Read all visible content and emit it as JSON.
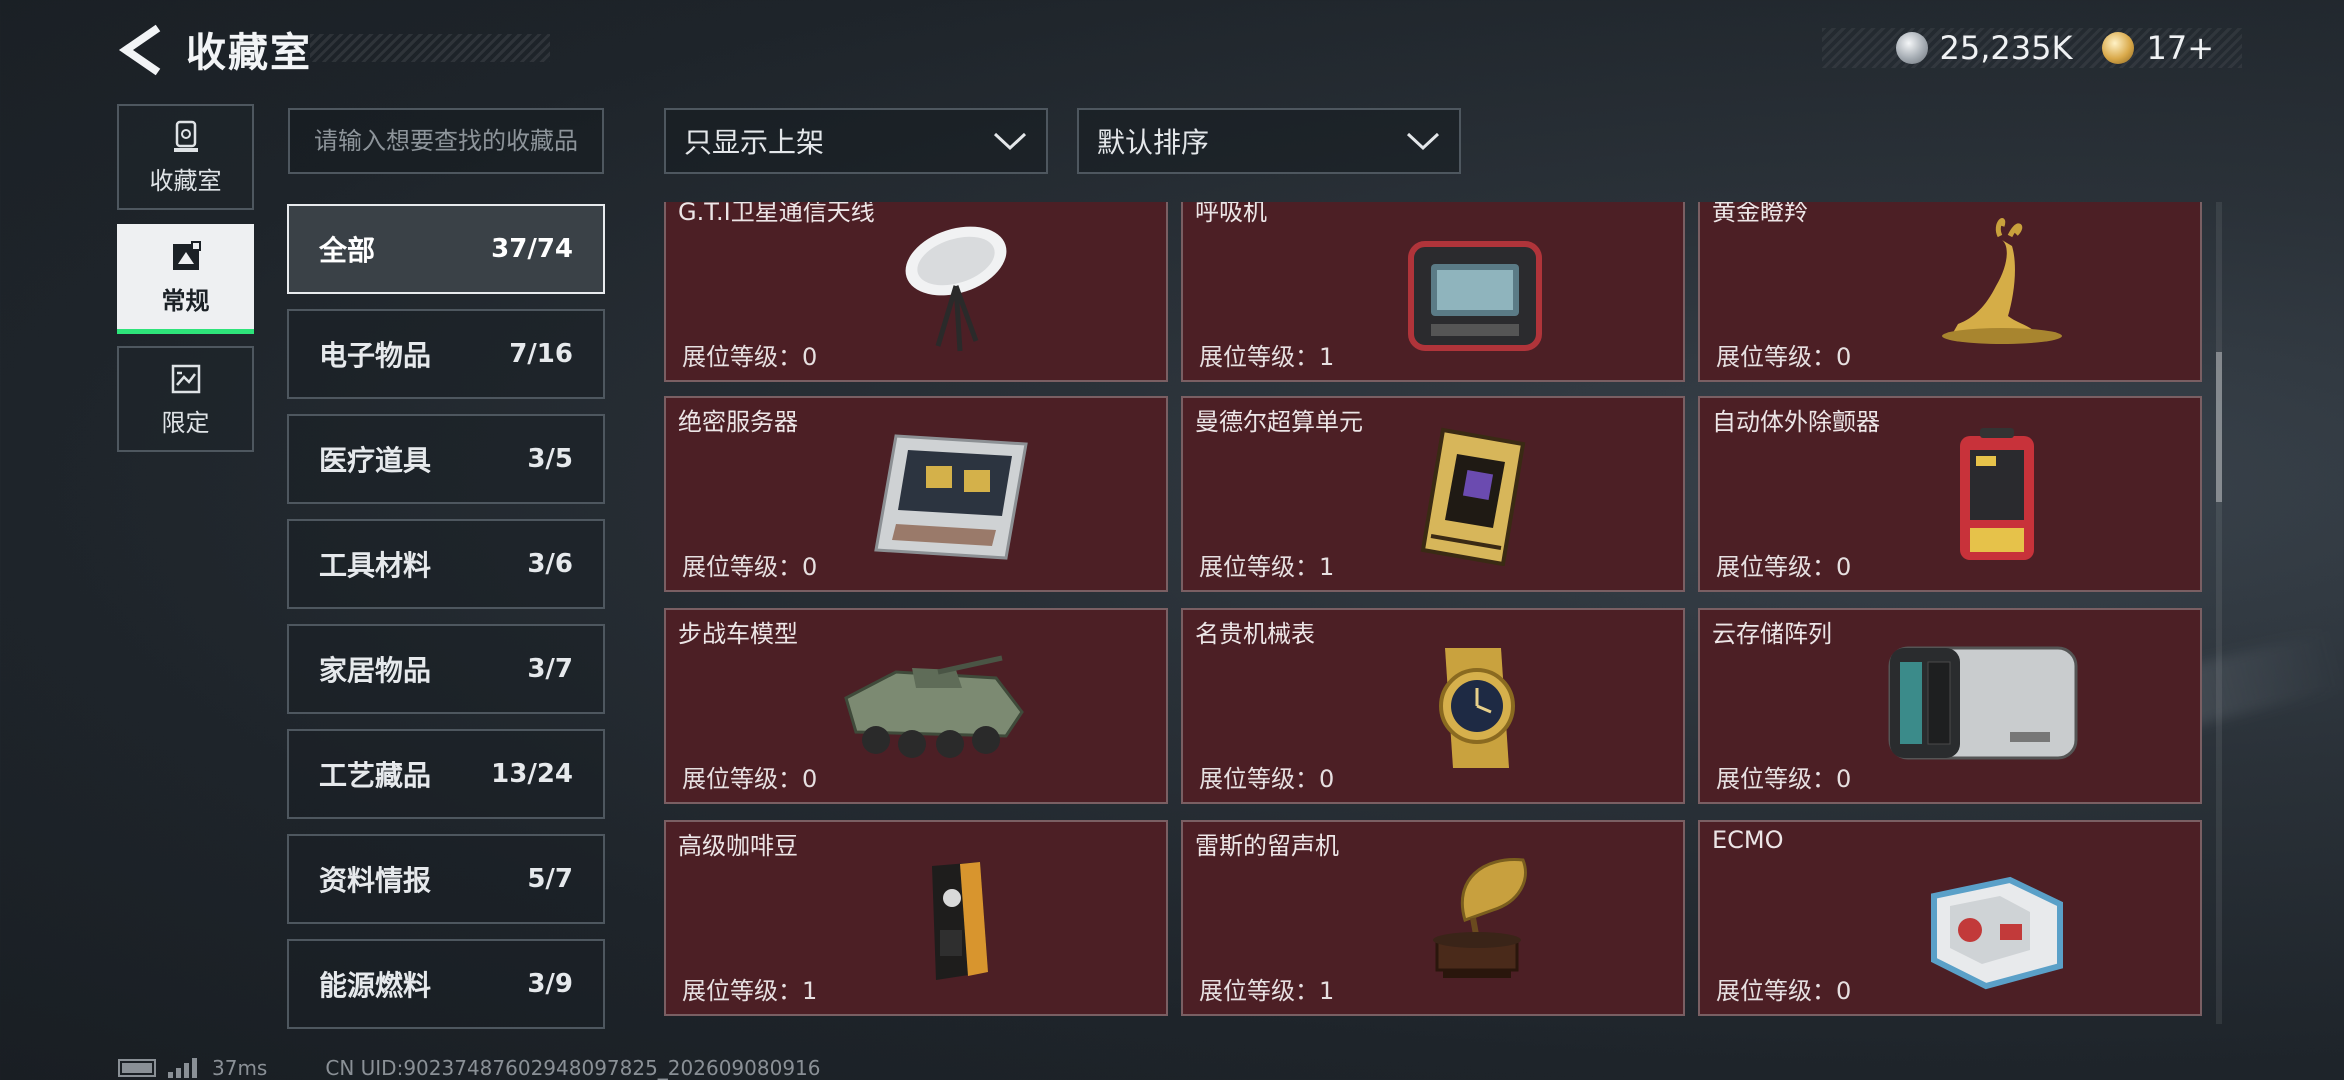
{
  "header": {
    "title": "收藏室",
    "currencies": [
      {
        "icon": "silver-coin-icon",
        "value": "25,235K"
      },
      {
        "icon": "gold-coin-icon",
        "value": "17+"
      }
    ]
  },
  "modes": [
    {
      "label": "收藏室",
      "icon": "trophy-icon",
      "active": false
    },
    {
      "label": "常规",
      "icon": "picture-icon",
      "active": true
    },
    {
      "label": "限定",
      "icon": "limited-frame-icon",
      "active": false
    }
  ],
  "search": {
    "placeholder": "请输入想要查找的收藏品",
    "value": ""
  },
  "filters": {
    "display_filter": {
      "label": "只显示上架"
    },
    "sort": {
      "label": "默认排序"
    }
  },
  "categories": [
    {
      "name": "全部",
      "count": "37/74",
      "active": true
    },
    {
      "name": "电子物品",
      "count": "7/16"
    },
    {
      "name": "医疗道具",
      "count": "3/5"
    },
    {
      "name": "工具材料",
      "count": "3/6"
    },
    {
      "name": "家居物品",
      "count": "3/7"
    },
    {
      "name": "工艺藏品",
      "count": "13/24"
    },
    {
      "name": "资料情报",
      "count": "5/7"
    },
    {
      "name": "能源燃料",
      "count": "3/9"
    }
  ],
  "level_label": "展位等级：",
  "items": [
    {
      "name": "G.T.I卫星通信天线",
      "level": "0",
      "icon": "satellite-dish-icon"
    },
    {
      "name": "呼吸机",
      "level": "1",
      "icon": "ventilator-icon"
    },
    {
      "name": "黄金瞪羚",
      "level": "0",
      "icon": "golden-gazelle-icon"
    },
    {
      "name": "绝密服务器",
      "level": "0",
      "icon": "server-icon"
    },
    {
      "name": "曼德尔超算单元",
      "level": "1",
      "icon": "supercomputer-unit-icon"
    },
    {
      "name": "自动体外除颤器",
      "level": "0",
      "icon": "defibrillator-icon"
    },
    {
      "name": "步战车模型",
      "level": "0",
      "icon": "ifv-model-icon"
    },
    {
      "name": "名贵机械表",
      "level": "0",
      "icon": "wristwatch-icon"
    },
    {
      "name": "云存储阵列",
      "level": "0",
      "icon": "storage-array-icon"
    },
    {
      "name": "高级咖啡豆",
      "level": "1",
      "icon": "coffee-bag-icon"
    },
    {
      "name": "雷斯的留声机",
      "level": "1",
      "icon": "gramophone-icon"
    },
    {
      "name": "ECMO",
      "level": "0",
      "icon": "ecmo-machine-icon"
    }
  ],
  "footer": {
    "ping": "37ms",
    "uid": "CN UID:902374876029480978​25_202609080916"
  }
}
